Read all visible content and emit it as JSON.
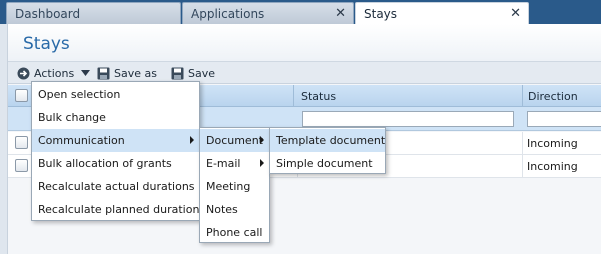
{
  "tabs": [
    {
      "label": "Dashboard",
      "closable": false
    },
    {
      "label": "Applications",
      "closable": true
    },
    {
      "label": "Stays",
      "closable": true,
      "active": true
    }
  ],
  "page": {
    "title": "Stays"
  },
  "toolbar": {
    "actions_label": "Actions",
    "save_as_label": "Save as",
    "save_label": "Save"
  },
  "grid": {
    "columns": [
      "",
      "Status",
      "Direction"
    ],
    "rows": [
      {
        "direction": "Incoming"
      },
      {
        "direction": "Incoming"
      }
    ]
  },
  "actions_menu": {
    "items": [
      "Open selection",
      "Bulk change",
      "Communication",
      "Bulk allocation of grants",
      "Recalculate actual durations",
      "Recalculate planned durations"
    ],
    "highlighted": "Communication"
  },
  "communication_menu": {
    "items": [
      "Document",
      "E-mail",
      "Meeting",
      "Notes",
      "Phone call"
    ],
    "highlighted": "Document"
  },
  "document_menu": {
    "items": [
      "Template document",
      "Simple document"
    ],
    "highlighted": "Template document"
  },
  "colors": {
    "tab_strip": "#2a5a8a",
    "title": "#2a6aa8",
    "header": "#cfe3f6",
    "highlight": "#cfe3f6"
  }
}
